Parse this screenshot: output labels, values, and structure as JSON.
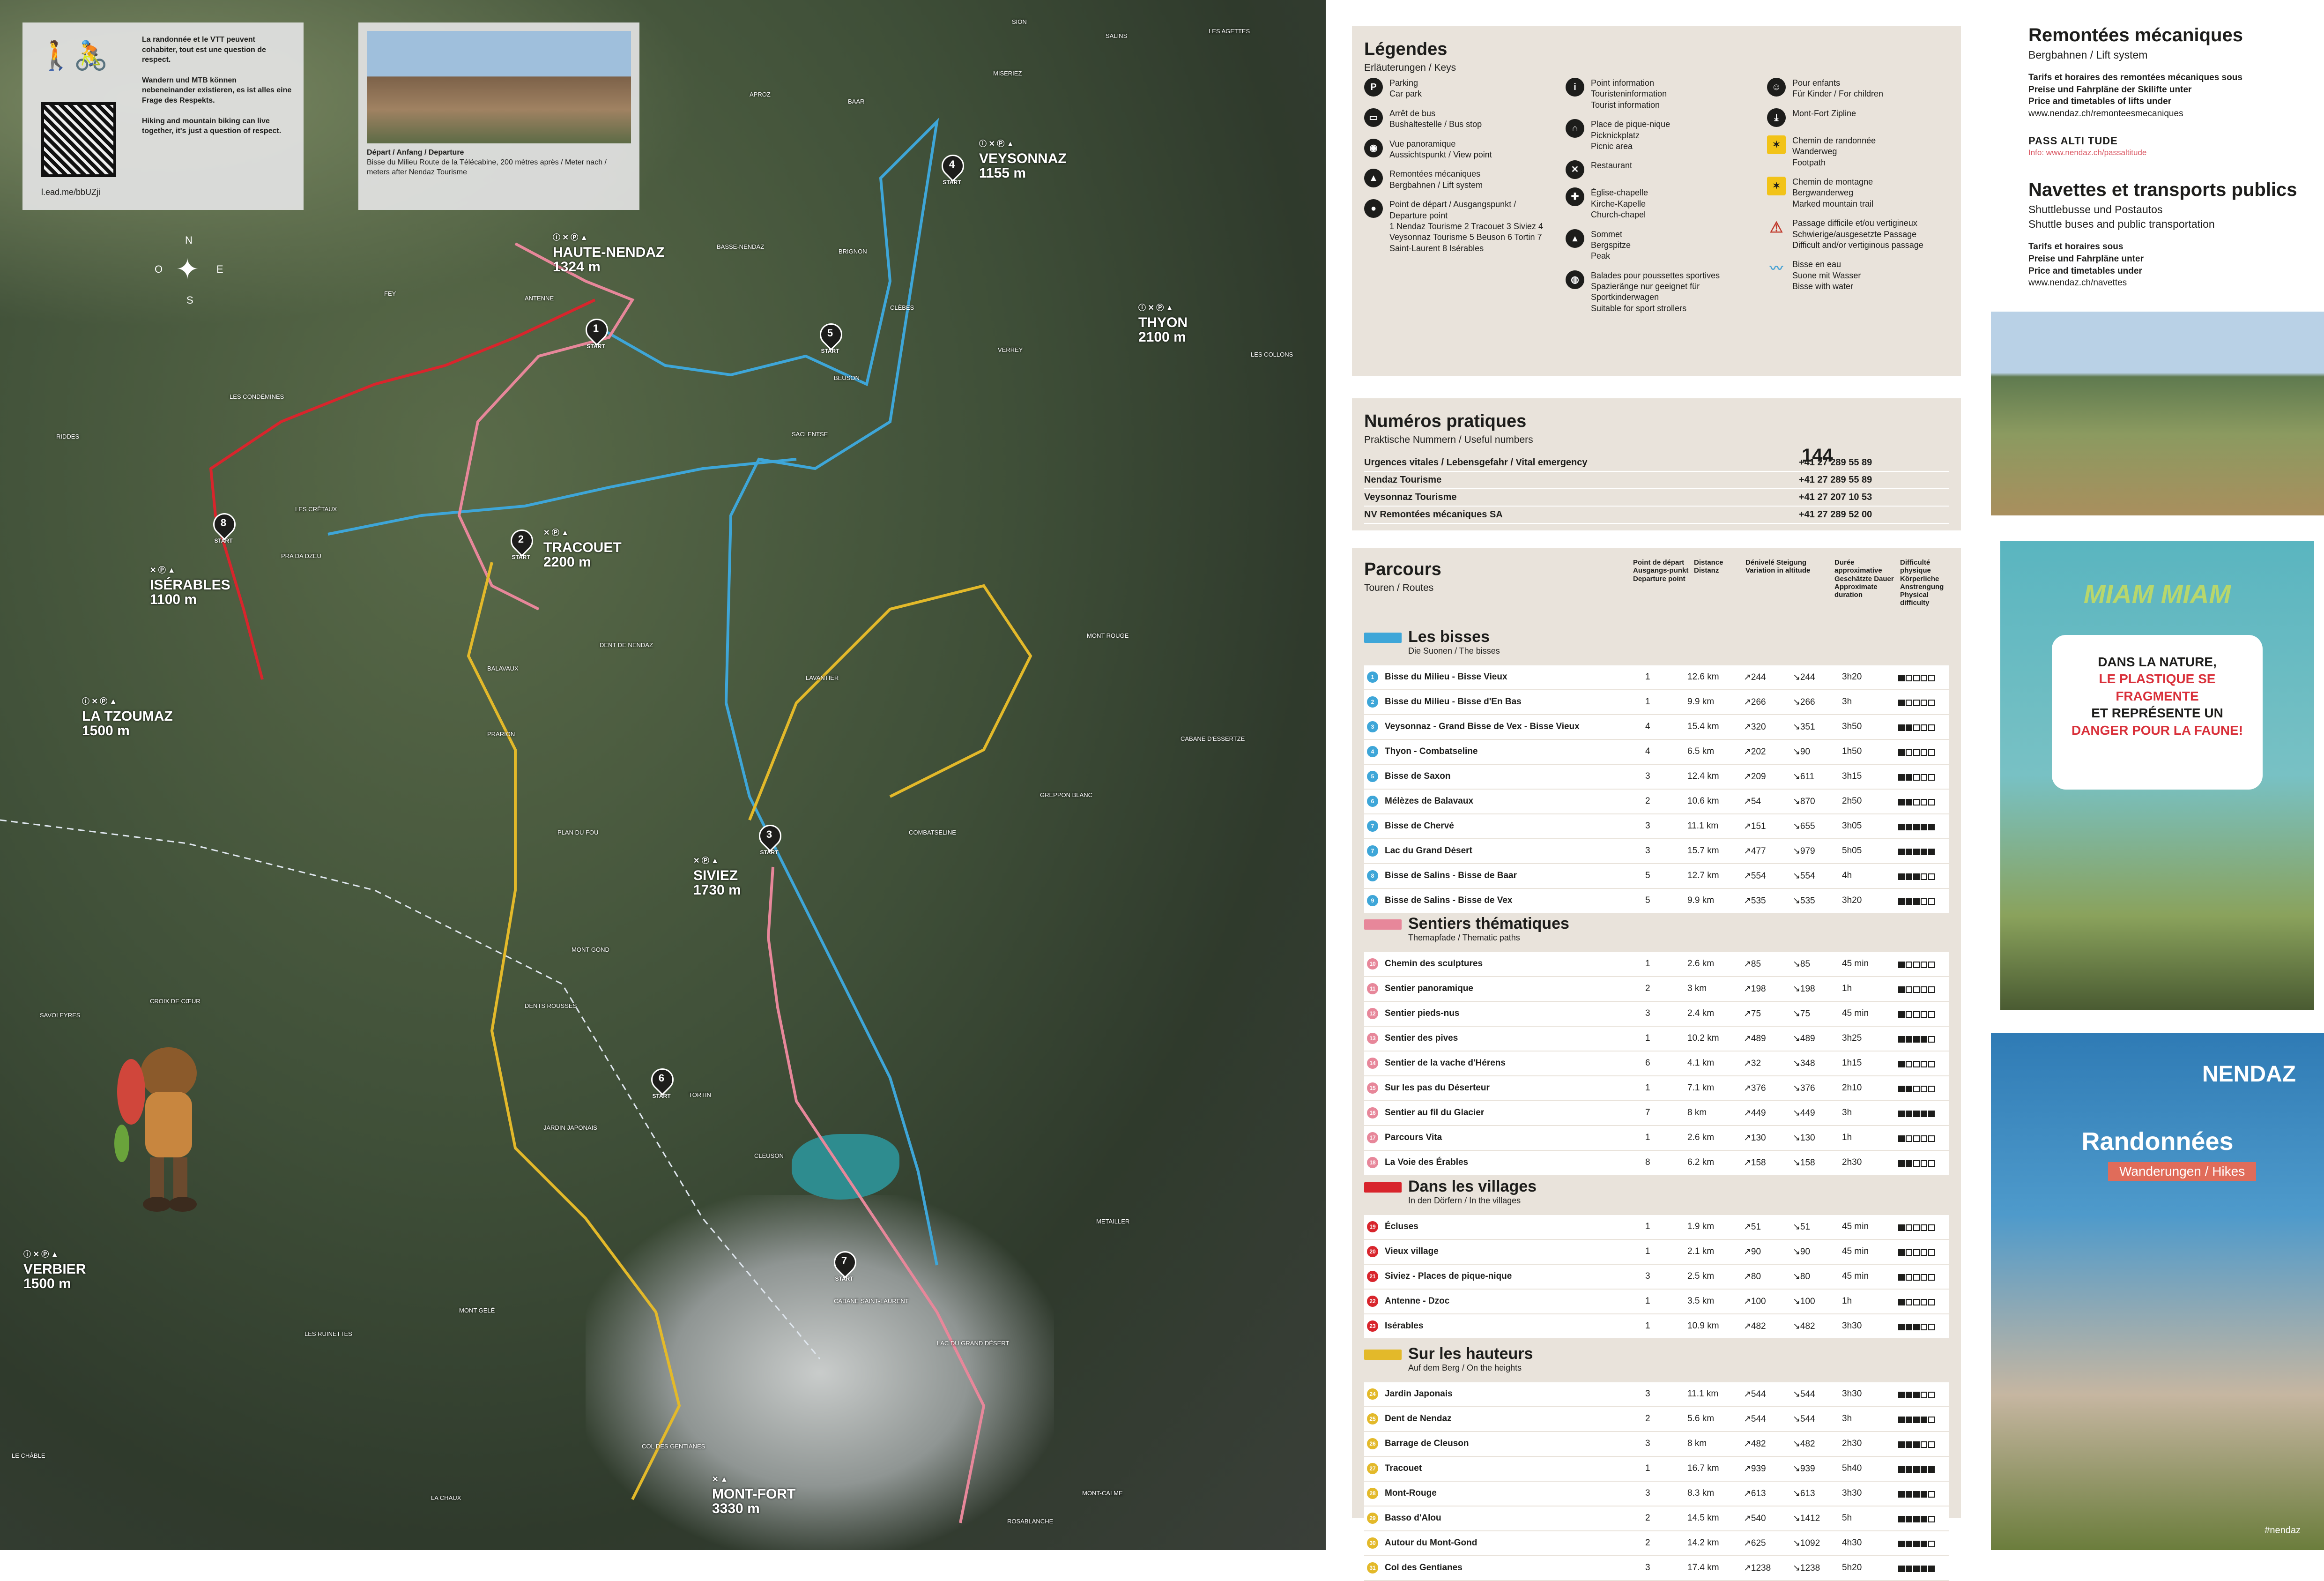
{
  "map": {
    "info": {
      "fr": "La randonnée et le VTT peuvent cohabiter, tout est une question de respect.",
      "de": "Wandern und MTB können nebeneinander existieren, es ist alles eine Frage des Respekts.",
      "en": "Hiking and mountain biking can live together, it's just a question of respect.",
      "link": "l.ead.me/bbUZji"
    },
    "departure": {
      "caption1": "Départ / Anfang / Departure",
      "caption2": "Bisse du Milieu Route de la Télécabine, 200 mètres après / Meter nach / meters after Nendaz Tourisme"
    },
    "compass": {
      "n": "N",
      "s": "S",
      "e": "E",
      "w": "O"
    },
    "big_places": [
      {
        "name": "HAUTE-NENDAZ",
        "alt": "1324 m"
      },
      {
        "name": "VEYSONNAZ",
        "alt": "1155 m"
      },
      {
        "name": "THYON",
        "alt": "2100 m"
      },
      {
        "name": "TRACOUET",
        "alt": "2200 m"
      },
      {
        "name": "ISÉRABLES",
        "alt": "1100 m"
      },
      {
        "name": "LA TZOUMAZ",
        "alt": "1500 m"
      },
      {
        "name": "SIVIEZ",
        "alt": "1730 m"
      },
      {
        "name": "VERBIER",
        "alt": "1500 m"
      },
      {
        "name": "MONT-FORT",
        "alt": "3330 m"
      }
    ],
    "small_places": [
      "SION",
      "LES AGETTES",
      "SALINS",
      "APROZ",
      "BAAR",
      "MISERIEZ",
      "BASSE-NENDAZ",
      "BRIGNON",
      "CLÈBES",
      "FEY",
      "ANTENNE",
      "LES CONDÉMINES",
      "RIDDES",
      "LES CRÊTAUX",
      "PRA DA DZEU",
      "BALAVAUX",
      "PRARION",
      "PLAN DU FOU",
      "MONT-GOND",
      "DENTS ROUSSES",
      "CROIX DE CŒUR",
      "SAVOLEYRES",
      "JARDIN JAPONAIS",
      "TORTIN",
      "CLEUSON",
      "CABANE SAINT-LAURENT",
      "LAC DU GRAND DÉSERT",
      "MONT GELÉ",
      "LES RUINETTES",
      "LA CHAUX",
      "LE CHÂBLE",
      "COL DES GENTIANES",
      "ROSABLANCHE",
      "MONT-CALME",
      "COMBATSELINE",
      "GREPPON BLANC",
      "CABANE D'ESSERTZE",
      "MONT ROUGE",
      "LAVANTIER",
      "SACLENTSE",
      "BEUSON",
      "VERREY",
      "LES COLLONS",
      "DENT DE NENDAZ",
      "METAILLER"
    ],
    "starts": [
      {
        "num": "1",
        "label": "START"
      },
      {
        "num": "2",
        "label": "START"
      },
      {
        "num": "3",
        "label": "START"
      },
      {
        "num": "4",
        "label": "START"
      },
      {
        "num": "5",
        "label": "START"
      },
      {
        "num": "6",
        "label": "START"
      },
      {
        "num": "7",
        "label": "START"
      },
      {
        "num": "8",
        "label": "START"
      }
    ],
    "route_colors": {
      "bisses": "#3ea6d8",
      "thematic": "#e7879a",
      "villages": "#d8252c",
      "heights": "#e3b92a"
    }
  },
  "legend": {
    "title": "Légendes",
    "sub": "Erläuterungen / Keys",
    "items": [
      {
        "icon": "parking-icon",
        "sym": "P",
        "text": "Parking\nCar park"
      },
      {
        "icon": "bus-icon",
        "sym": "▭",
        "text": "Arrêt de bus\nBushaltestelle / Bus stop"
      },
      {
        "icon": "view-icon",
        "sym": "◉",
        "text": "Vue panoramique\nAussichtspunkt / View point"
      },
      {
        "icon": "lift-icon",
        "sym": "▲",
        "text": "Remontées mécaniques\nBergbahnen / Lift system"
      },
      {
        "icon": "start-pin-icon",
        "sym": "●",
        "text": "Point de départ / Ausgangspunkt / Departure point\n1 Nendaz Tourisme  2 Tracouet  3 Siviez  4 Veysonnaz Tourisme  5 Beuson  6 Tortin  7 Saint-Laurent  8 Isérables"
      },
      {
        "icon": "info-icon",
        "sym": "i",
        "text": "Point information\nTouristeninformation\nTourist information"
      },
      {
        "icon": "picnic-icon",
        "sym": "⌂",
        "text": "Place de pique-nique\nPicknickplatz\nPicnic area"
      },
      {
        "icon": "restaurant-icon",
        "sym": "✕",
        "text": "Restaurant"
      },
      {
        "icon": "chapel-icon",
        "sym": "✚",
        "text": "Église-chapelle\nKirche-Kapelle\nChurch-chapel"
      },
      {
        "icon": "summit-icon",
        "sym": "▴",
        "text": "Sommet\nBergspitze\nPeak"
      },
      {
        "icon": "stroller-icon",
        "sym": "◍",
        "text": "Balades pour poussettes sportives\nSpazieränge nur geeignet für Sportkinderwagen\nSuitable for sport strollers"
      },
      {
        "icon": "children-icon",
        "sym": "☺",
        "text": "Pour enfants\nFür Kinder / For children"
      },
      {
        "icon": "zipline-icon",
        "sym": "⤓",
        "text": "Mont-Fort Zipline"
      },
      {
        "icon": "footpath-icon",
        "sym": "✶",
        "text": "Chemin de randonnée\nWanderweg\nFootpath"
      },
      {
        "icon": "mountain-trail-icon",
        "sym": "✶",
        "text": "Chemin de montagne\nBergwanderweg\nMarked mountain trail"
      },
      {
        "icon": "warning-icon",
        "sym": "⚠",
        "text": "Passage difficile et/ou vertigineux\nSchwierige/ausgesetzte Passage\nDifficult and/or vertiginous passage"
      },
      {
        "icon": "water-icon",
        "sym": "〰",
        "text": "Bisse en eau\nSuone mit Wasser\nBisse with water"
      }
    ]
  },
  "numbers": {
    "title": "Numéros pratiques",
    "sub": "Praktische Nummern / Useful numbers",
    "big": "144",
    "rows": [
      {
        "label": "Urgences vitales / Lebensgefahr / Vital emergency",
        "num": "+41 27 289 55 89"
      },
      {
        "label": "Nendaz Tourisme",
        "num": "+41 27 289 55 89"
      },
      {
        "label": "Veysonnaz Tourisme",
        "num": "+41 27 207 10 53"
      },
      {
        "label": "NV Remontées mécaniques SA",
        "num": "+41 27 289 52 00"
      }
    ]
  },
  "parcours": {
    "title": "Parcours",
    "sub": "Touren / Routes",
    "headers": {
      "start": "Point de départ Ausgangs-punkt Departure point",
      "dist": "Distance Distanz",
      "elev": "Dénivelé Steigung Variation in altitude",
      "dur": "Durée approximative Geschätzte Dauer Approximate duration",
      "diff": "Difficulté physique Körperliche Anstrengung Physical difficulty"
    },
    "sections": [
      {
        "title": "Les bisses",
        "sub": "Die Suonen / The bisses",
        "color": "#3ea6d8",
        "rows": [
          {
            "n": "1",
            "name": "Bisse du Milieu - Bisse Vieux",
            "start": "1",
            "dist": "12.6 km",
            "up": "244",
            "down": "244",
            "dur": "3h20",
            "diff": 1
          },
          {
            "n": "2",
            "name": "Bisse du Milieu - Bisse d'En Bas",
            "start": "1",
            "dist": "9.9 km",
            "up": "266",
            "down": "266",
            "dur": "3h",
            "diff": 1
          },
          {
            "n": "3",
            "name": "Veysonnaz - Grand Bisse de Vex - Bisse Vieux",
            "start": "4",
            "dist": "15.4 km",
            "up": "320",
            "down": "351",
            "dur": "3h50",
            "diff": 2
          },
          {
            "n": "4",
            "name": "Thyon - Combatseline",
            "start": "4",
            "dist": "6.5 km",
            "up": "202",
            "down": "90",
            "dur": "1h50",
            "diff": 1
          },
          {
            "n": "5",
            "name": "Bisse de Saxon",
            "start": "3",
            "dist": "12.4 km",
            "up": "209",
            "down": "611",
            "dur": "3h15",
            "diff": 2
          },
          {
            "n": "6",
            "name": "Mélèzes de Balavaux",
            "start": "2",
            "dist": "10.6 km",
            "up": "54",
            "down": "870",
            "dur": "2h50",
            "diff": 2
          },
          {
            "n": "7",
            "name": "Bisse de Chervé",
            "start": "3",
            "dist": "11.1 km",
            "up": "151",
            "down": "655",
            "dur": "3h05",
            "diff": 5
          },
          {
            "n": "7",
            "name": "Lac du Grand Désert",
            "start": "3",
            "dist": "15.7 km",
            "up": "477",
            "down": "979",
            "dur": "5h05",
            "diff": 5
          },
          {
            "n": "8",
            "name": "Bisse de Salins - Bisse de Baar",
            "start": "5",
            "dist": "12.7 km",
            "up": "554",
            "down": "554",
            "dur": "4h",
            "diff": 3
          },
          {
            "n": "9",
            "name": "Bisse de Salins - Bisse de Vex",
            "start": "5",
            "dist": "9.9 km",
            "up": "535",
            "down": "535",
            "dur": "3h20",
            "diff": 3
          }
        ]
      },
      {
        "title": "Sentiers thématiques",
        "sub": "Themapfade / Thematic paths",
        "color": "#e7879a",
        "rows": [
          {
            "n": "10",
            "name": "Chemin des sculptures",
            "start": "1",
            "dist": "2.6 km",
            "up": "85",
            "down": "85",
            "dur": "45 min",
            "diff": 1
          },
          {
            "n": "11",
            "name": "Sentier panoramique",
            "start": "2",
            "dist": "3 km",
            "up": "198",
            "down": "198",
            "dur": "1h",
            "diff": 1
          },
          {
            "n": "12",
            "name": "Sentier pieds-nus",
            "start": "3",
            "dist": "2.4 km",
            "up": "75",
            "down": "75",
            "dur": "45 min",
            "diff": 1
          },
          {
            "n": "13",
            "name": "Sentier des pives",
            "start": "1",
            "dist": "10.2 km",
            "up": "489",
            "down": "489",
            "dur": "3h25",
            "diff": 4
          },
          {
            "n": "14",
            "name": "Sentier de la vache d'Hérens",
            "start": "6",
            "dist": "4.1 km",
            "up": "32",
            "down": "348",
            "dur": "1h15",
            "diff": 1
          },
          {
            "n": "15",
            "name": "Sur les pas du Déserteur",
            "start": "1",
            "dist": "7.1 km",
            "up": "376",
            "down": "376",
            "dur": "2h10",
            "diff": 2
          },
          {
            "n": "16",
            "name": "Sentier au fil du Glacier",
            "start": "7",
            "dist": "8 km",
            "up": "449",
            "down": "449",
            "dur": "3h",
            "diff": 5
          },
          {
            "n": "17",
            "name": "Parcours Vita",
            "start": "1",
            "dist": "2.6 km",
            "up": "130",
            "down": "130",
            "dur": "1h",
            "diff": 1
          },
          {
            "n": "18",
            "name": "La Voie des Érables",
            "start": "8",
            "dist": "6.2 km",
            "up": "158",
            "down": "158",
            "dur": "2h30",
            "diff": 2
          }
        ]
      },
      {
        "title": "Dans les villages",
        "sub": "In den Dörfern / In the villages",
        "color": "#d8252c",
        "rows": [
          {
            "n": "19",
            "name": "Écluses",
            "start": "1",
            "dist": "1.9 km",
            "up": "51",
            "down": "51",
            "dur": "45 min",
            "diff": 1
          },
          {
            "n": "20",
            "name": "Vieux village",
            "start": "1",
            "dist": "2.1 km",
            "up": "90",
            "down": "90",
            "dur": "45 min",
            "diff": 1
          },
          {
            "n": "21",
            "name": "Siviez - Places de pique-nique",
            "start": "3",
            "dist": "2.5 km",
            "up": "80",
            "down": "80",
            "dur": "45 min",
            "diff": 1
          },
          {
            "n": "22",
            "name": "Antenne - Dzoc",
            "start": "1",
            "dist": "3.5 km",
            "up": "100",
            "down": "100",
            "dur": "1h",
            "diff": 1
          },
          {
            "n": "23",
            "name": "Isérables",
            "start": "1",
            "dist": "10.9 km",
            "up": "482",
            "down": "482",
            "dur": "3h30",
            "diff": 3
          }
        ]
      },
      {
        "title": "Sur les hauteurs",
        "sub": "Auf dem Berg / On the heights",
        "color": "#e3b92a",
        "rows": [
          {
            "n": "24",
            "name": "Jardin Japonais",
            "start": "3",
            "dist": "11.1 km",
            "up": "544",
            "down": "544",
            "dur": "3h30",
            "diff": 3
          },
          {
            "n": "25",
            "name": "Dent de Nendaz",
            "start": "2",
            "dist": "5.6 km",
            "up": "544",
            "down": "544",
            "dur": "3h",
            "diff": 4
          },
          {
            "n": "26",
            "name": "Barrage de Cleuson",
            "start": "3",
            "dist": "8 km",
            "up": "482",
            "down": "482",
            "dur": "2h30",
            "diff": 3
          },
          {
            "n": "27",
            "name": "Tracouet",
            "start": "1",
            "dist": "16.7 km",
            "up": "939",
            "down": "939",
            "dur": "5h40",
            "diff": 5
          },
          {
            "n": "28",
            "name": "Mont-Rouge",
            "start": "3",
            "dist": "8.3 km",
            "up": "613",
            "down": "613",
            "dur": "3h30",
            "diff": 4
          },
          {
            "n": "29",
            "name": "Basso d'Alou",
            "start": "2",
            "dist": "14.5 km",
            "up": "540",
            "down": "1412",
            "dur": "5h",
            "diff": 4
          },
          {
            "n": "30",
            "name": "Autour du Mont-Gond",
            "start": "2",
            "dist": "14.2 km",
            "up": "625",
            "down": "1092",
            "dur": "4h30",
            "diff": 4
          },
          {
            "n": "31",
            "name": "Col des Gentianes",
            "start": "3",
            "dist": "17.4 km",
            "up": "1238",
            "down": "1238",
            "dur": "5h20",
            "diff": 5
          }
        ]
      }
    ]
  },
  "lifts": {
    "title": "Remontées mécaniques",
    "sub": "Bergbahnen / Lift system",
    "lines": [
      "Tarifs et horaires des remontées mécaniques sous",
      "Preise und Fahrpläne der Skilifte unter",
      "Price and timetables of lifts under"
    ],
    "url": "www.nendaz.ch/remonteesmecaniques",
    "pass": "PASS ALTI TUDE",
    "info": "Info: www.nendaz.ch/passaltitude",
    "title2": "Navettes et transports publics",
    "sub2a": "Shuttlebusse und Postautos",
    "sub2b": "Shuttle buses and public transportation",
    "lines2": [
      "Tarifs et horaires sous",
      "Preise und Fahrpläne unter",
      "Price and timetables under"
    ],
    "url2": "www.nendaz.ch/navettes"
  },
  "miam": {
    "title": "MIAM MIAM",
    "l1": "DANS LA NATURE,",
    "l2": "LE PLASTIQUE SE FRAGMENTE",
    "l3": "ET REPRÉSENTE UN",
    "l4": "DANGER POUR LA FAUNE!"
  },
  "cover": {
    "brand": "NENDAZ",
    "title": "Randonnées",
    "tag": "Wanderungen / Hikes",
    "hash": "#nendaz"
  }
}
